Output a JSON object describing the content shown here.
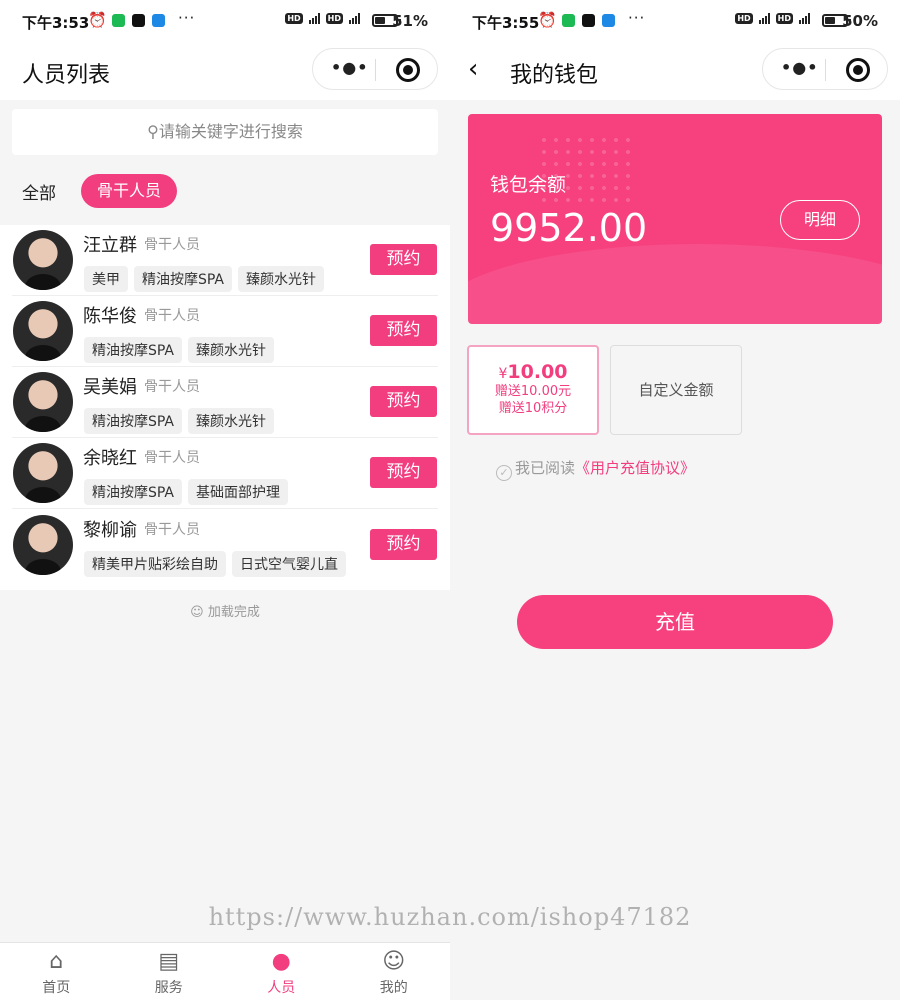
{
  "left": {
    "status": {
      "time": "下午3:53",
      "battery": "51%",
      "battery_level": 0.51
    },
    "nav": {
      "title": "人员列表"
    },
    "search": {
      "placeholder": "请输关键字进行搜索"
    },
    "filter": {
      "all": "全部",
      "selected": "骨干人员"
    },
    "staff": [
      {
        "name": "汪立群",
        "role": "骨干人员",
        "tags": [
          "美甲",
          "精油按摩SPA",
          "臻颜水光针"
        ],
        "button": "预约"
      },
      {
        "name": "陈华俊",
        "role": "骨干人员",
        "tags": [
          "精油按摩SPA",
          "臻颜水光针"
        ],
        "button": "预约"
      },
      {
        "name": "吴美娟",
        "role": "骨干人员",
        "tags": [
          "精油按摩SPA",
          "臻颜水光针"
        ],
        "button": "预约"
      },
      {
        "name": "余晓红",
        "role": "骨干人员",
        "tags": [
          "精油按摩SPA",
          "基础面部护理"
        ],
        "button": "预约"
      },
      {
        "name": "黎柳谕",
        "role": "骨干人员",
        "tags": [
          "精美甲片贴彩绘自助",
          "日式空气婴儿直"
        ],
        "button": "预约"
      }
    ],
    "loaded": "☺ 加载完成",
    "tabs": [
      {
        "label": "首页",
        "icon": "home-icon"
      },
      {
        "label": "服务",
        "icon": "calendar-icon"
      },
      {
        "label": "人员",
        "icon": "person-icon"
      },
      {
        "label": "我的",
        "icon": "smile-icon"
      }
    ],
    "active_tab": "人员"
  },
  "right": {
    "status": {
      "time": "下午3:55",
      "battery": "50%",
      "battery_level": 0.5
    },
    "nav": {
      "title": "我的钱包",
      "back": "‹"
    },
    "wallet": {
      "label": "钱包余额",
      "amount": "9952.00",
      "detail_button": "明细"
    },
    "options": [
      {
        "currency": "¥",
        "price": "10.00",
        "gift1": "赠送10.00元",
        "gift2": "赠送10积分",
        "selected": true
      },
      {
        "custom": "自定义金额",
        "selected": false
      }
    ],
    "agreement": {
      "text": "我已阅读",
      "link": "《用户充值协议》"
    },
    "recharge_button": "充值"
  },
  "watermark": "https://www.huzhan.com/ishop47182",
  "colors": {
    "accent": "#f23d7f",
    "card": "#f7417f"
  }
}
